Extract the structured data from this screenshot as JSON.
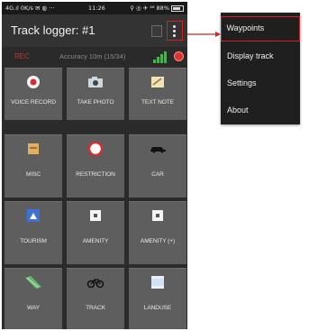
{
  "status_bar": {
    "left": "4G.ıl  0K/s ✉ ◍ ···",
    "time": "11:26",
    "right": "⚲ ◎ ✈ ⁴⁶ 88%"
  },
  "app_bar": {
    "title": "Track logger: #1"
  },
  "accuracy_bar": {
    "rec_label": "REC",
    "accuracy_text": "Accuracy 10m (15/34)",
    "signal_color": "#4caf50",
    "stop_color": "#dd3333"
  },
  "tiles": [
    {
      "label": "VOICE RECORD",
      "icon": "record-icon"
    },
    {
      "label": "TAKE PHOTO",
      "icon": "camera-icon"
    },
    {
      "label": "TEXT NOTE",
      "icon": "note-icon"
    },
    {
      "label": "MISC",
      "icon": "misc-icon"
    },
    {
      "label": "RESTRICTION",
      "icon": "restriction-icon"
    },
    {
      "label": "CAR",
      "icon": "car-icon"
    },
    {
      "label": "TOURISM",
      "icon": "tourism-icon"
    },
    {
      "label": "AMENITY",
      "icon": "amenity-icon"
    },
    {
      "label": "AMENITY (+)",
      "icon": "amenity-plus-icon"
    },
    {
      "label": "WAY",
      "icon": "way-icon"
    },
    {
      "label": "TRACK",
      "icon": "bicycle-icon"
    },
    {
      "label": "LANDUSE",
      "icon": "landuse-icon"
    }
  ],
  "menu": {
    "items": [
      {
        "label": "Waypoints"
      },
      {
        "label": "Display track"
      },
      {
        "label": "Settings"
      },
      {
        "label": "About"
      }
    ],
    "highlight_color": "#d32222"
  }
}
